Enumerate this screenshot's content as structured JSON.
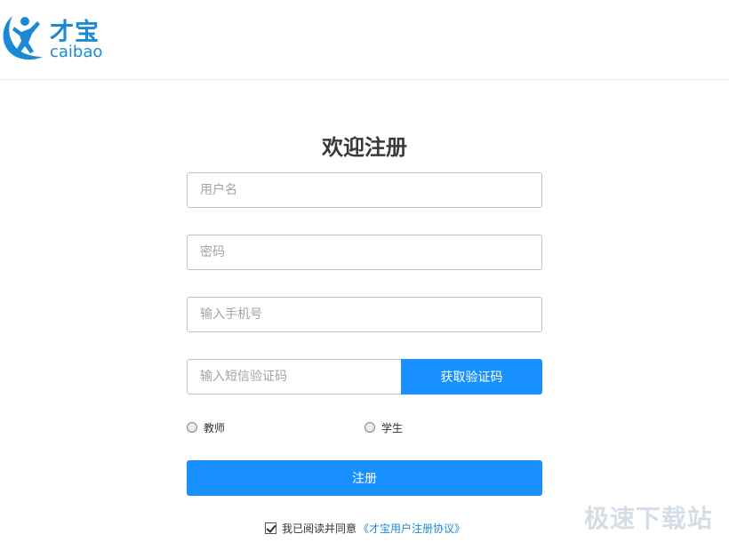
{
  "header": {
    "logo_cn": "才宝",
    "logo_en": "caibao"
  },
  "form": {
    "title": "欢迎注册",
    "username_placeholder": "用户名",
    "password_placeholder": "密码",
    "phone_placeholder": "输入手机号",
    "sms_placeholder": "输入短信验证码",
    "get_code_label": "获取验证码",
    "roles": [
      {
        "label": "教师",
        "selected": false
      },
      {
        "label": "学生",
        "selected": false
      }
    ],
    "register_label": "注册",
    "agree_checked": true,
    "agree_text": "我已阅读并同意",
    "agreement_link": "《才宝用户注册协议》"
  },
  "watermark": "极速下载站",
  "colors": {
    "brand": "#1a8ad6",
    "primary_button": "#1890ff",
    "input_border": "#b8c4d0"
  },
  "icons": {
    "logo_mark": "person-jumping-icon"
  }
}
